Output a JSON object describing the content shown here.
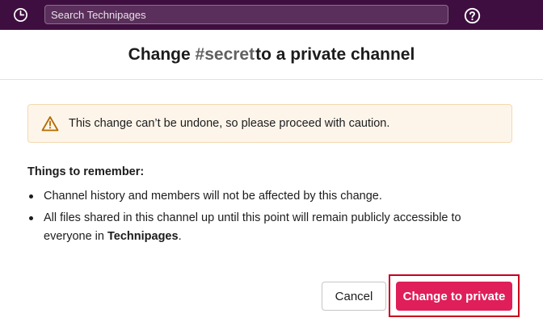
{
  "topbar": {
    "history_icon": "clock-icon",
    "search_placeholder": "Search Technipages",
    "help_icon": "question-circle-icon"
  },
  "dialog": {
    "title_prefix": "Change",
    "channel_name": "#secret",
    "title_suffix": "to a private channel",
    "warning_icon": "warning-triangle-icon",
    "warning_text": "This change can’t be undone, so please proceed with caution.",
    "remember_title": "Things to remember:",
    "tips": [
      {
        "text": "Channel history and members will not be affected by this change."
      },
      {
        "text": "All files shared in this channel up until this point will remain publicly accessible to everyone in ",
        "bold": "Technipages",
        "after": "."
      }
    ],
    "cancel_label": "Cancel",
    "confirm_label": "Change to private"
  },
  "colors": {
    "topbar": "#3f0e40",
    "primary": "#e01e5a",
    "warning_bg": "#fdf5ea",
    "highlight": "#c8001e"
  }
}
